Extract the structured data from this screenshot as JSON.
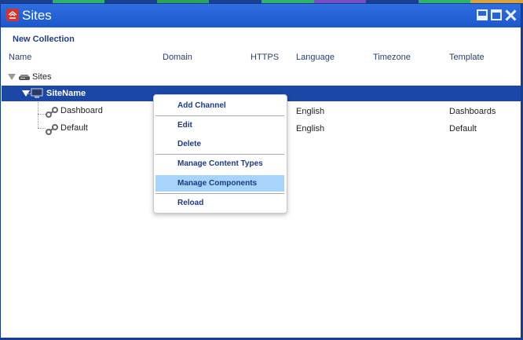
{
  "window": {
    "title": "Sites",
    "title_bar_color": "#1b57cd"
  },
  "toolbar": {
    "new_collection_label": "New Collection"
  },
  "table": {
    "columns": [
      "Name",
      "Domain",
      "HTTPS",
      "Language",
      "Timezone",
      "Template"
    ]
  },
  "tree": {
    "root_label": "Sites",
    "site": {
      "label": "SiteName",
      "selected_color": "#1b47a6"
    },
    "channels": [
      {
        "name": "Dashboard",
        "language": "English",
        "template": "Dashboards"
      },
      {
        "name": "Default",
        "language": "English",
        "template": "Default"
      }
    ]
  },
  "context_menu": {
    "items": [
      {
        "label": "Add Channel"
      },
      {
        "label": "Edit"
      },
      {
        "label": "Delete"
      },
      {
        "label": "Manage Content Types"
      },
      {
        "label": "Manage Components"
      },
      {
        "label": "Reload"
      }
    ],
    "active_item": "Manage Components",
    "active_color": "#a6d4fb"
  }
}
